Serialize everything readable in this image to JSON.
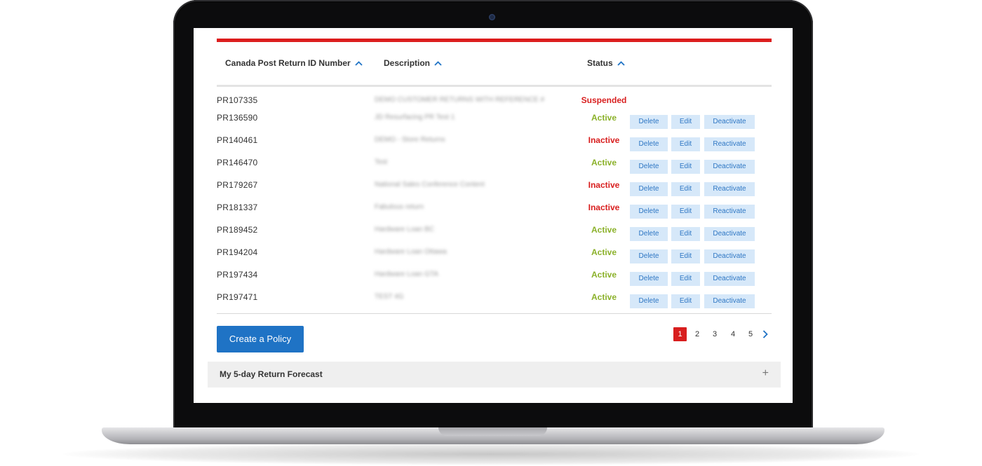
{
  "table": {
    "columns": [
      {
        "label": "Canada Post Return ID Number"
      },
      {
        "label": "Description"
      },
      {
        "label": "Status"
      }
    ],
    "rows": [
      {
        "id": "PR107335",
        "description": "DEMO CUSTOMER RETURNS WITH REFERENCE #",
        "status": "Suspended",
        "status_kind": "suspended",
        "actions": []
      },
      {
        "id": "PR136590",
        "description": "JD Resurfacing PR Test 1",
        "status": "Active",
        "status_kind": "active",
        "actions": [
          "Delete",
          "Edit",
          "Deactivate"
        ]
      },
      {
        "id": "PR140461",
        "description": "DEMO - Store Returns",
        "status": "Inactive",
        "status_kind": "inactive",
        "actions": [
          "Delete",
          "Edit",
          "Reactivate"
        ]
      },
      {
        "id": "PR146470",
        "description": "Test",
        "status": "Active",
        "status_kind": "active",
        "actions": [
          "Delete",
          "Edit",
          "Deactivate"
        ]
      },
      {
        "id": "PR179267",
        "description": "National Sales Conference Content",
        "status": "Inactive",
        "status_kind": "inactive",
        "actions": [
          "Delete",
          "Edit",
          "Reactivate"
        ]
      },
      {
        "id": "PR181337",
        "description": "Fabulous return",
        "status": "Inactive",
        "status_kind": "inactive",
        "actions": [
          "Delete",
          "Edit",
          "Reactivate"
        ]
      },
      {
        "id": "PR189452",
        "description": "Hardware Loan BC",
        "status": "Active",
        "status_kind": "active",
        "actions": [
          "Delete",
          "Edit",
          "Deactivate"
        ]
      },
      {
        "id": "PR194204",
        "description": "Hardware Loan Ottawa",
        "status": "Active",
        "status_kind": "active",
        "actions": [
          "Delete",
          "Edit",
          "Deactivate"
        ]
      },
      {
        "id": "PR197434",
        "description": "Hardware Loan GTA",
        "status": "Active",
        "status_kind": "active",
        "actions": [
          "Delete",
          "Edit",
          "Deactivate"
        ]
      },
      {
        "id": "PR197471",
        "description": "TEST 4G",
        "status": "Active",
        "status_kind": "active",
        "actions": [
          "Delete",
          "Edit",
          "Deactivate"
        ]
      }
    ]
  },
  "create_button": {
    "label": "Create a Policy"
  },
  "pagination": {
    "pages": [
      "1",
      "2",
      "3",
      "4",
      "5"
    ],
    "current": "1",
    "next_icon": "chevron-right-icon"
  },
  "forecast": {
    "title": "My 5-day Return Forecast",
    "expand_label": "+"
  },
  "colors": {
    "brand_red": "#dc1d1d",
    "primary_blue": "#1f73c5",
    "active_green": "#8bb12a",
    "inactive_red": "#d81e1e",
    "action_bg": "#d6e8f9"
  }
}
